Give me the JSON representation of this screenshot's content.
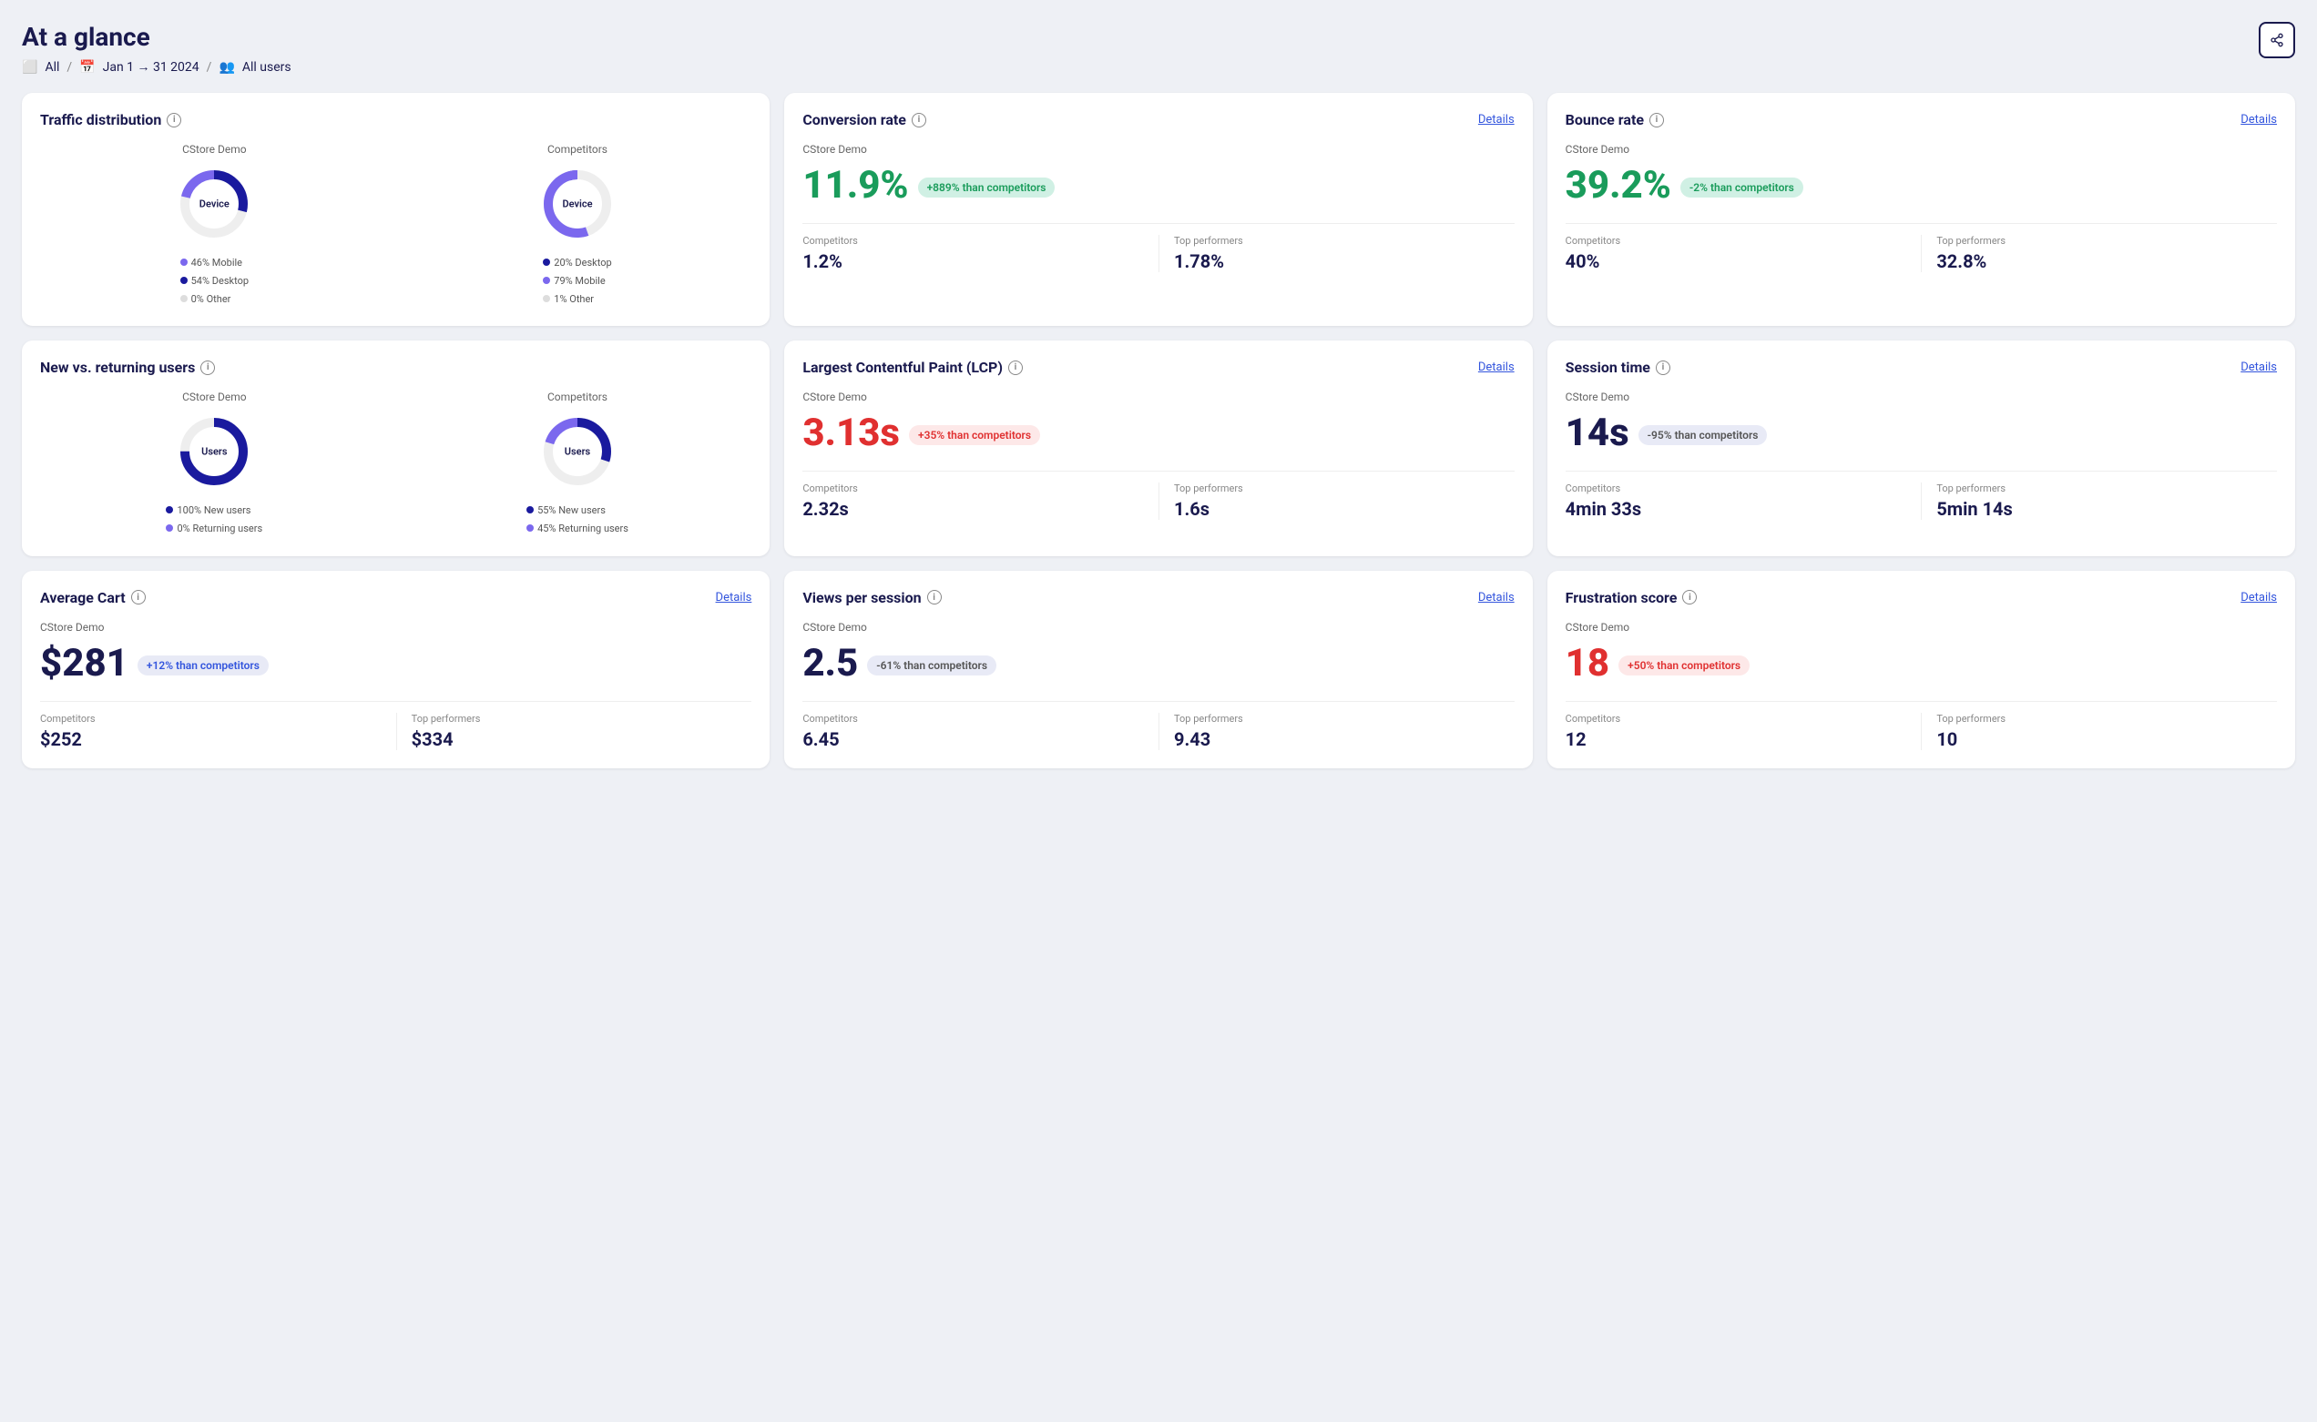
{
  "header": {
    "title": "At a glance",
    "filter_all": "All",
    "filter_date": "Jan 1 → 31 2024",
    "filter_users": "All users",
    "share_label": "share"
  },
  "cards": {
    "traffic": {
      "title": "Traffic distribution",
      "cstore_label": "CStore Demo",
      "competitors_label": "Competitors",
      "cstore_donut_center": "Device",
      "competitors_donut_center": "Device",
      "cstore_legend": [
        "46% Mobile",
        "54% Desktop",
        "0% Other"
      ],
      "competitors_legend": [
        "20% Desktop",
        "79% Mobile",
        "1% Other"
      ],
      "cstore_colors": [
        "#7b68ee",
        "#1a1a9e",
        "#ddd"
      ],
      "competitors_colors": [
        "#1a1a9e",
        "#7b68ee",
        "#ddd"
      ],
      "cstore_pcts": [
        46,
        54,
        0
      ],
      "competitors_pcts": [
        20,
        79,
        1
      ]
    },
    "conversion": {
      "title": "Conversion rate",
      "details_label": "Details",
      "cstore_label": "CStore Demo",
      "big_value": "11.9%",
      "badge_text": "+889% than competitors",
      "badge_type": "green",
      "competitors_label": "Competitors",
      "competitors_value": "1.2%",
      "top_performers_label": "Top performers",
      "top_performers_value": "1.78%"
    },
    "bounce": {
      "title": "Bounce rate",
      "details_label": "Details",
      "cstore_label": "CStore Demo",
      "big_value": "39.2%",
      "badge_text": "-2% than competitors",
      "badge_type": "green",
      "competitors_label": "Competitors",
      "competitors_value": "40%",
      "top_performers_label": "Top performers",
      "top_performers_value": "32.8%"
    },
    "new_returning": {
      "title": "New vs. returning users",
      "cstore_label": "CStore Demo",
      "competitors_label": "Competitors",
      "cstore_donut_center": "Users",
      "competitors_donut_center": "Users",
      "cstore_legend": [
        "100% New users",
        "0% Returning users"
      ],
      "competitors_legend": [
        "55% New users",
        "45% Returning users"
      ],
      "cstore_colors": [
        "#1a1a9e",
        "#7b68ee"
      ],
      "competitors_colors": [
        "#1a1a9e",
        "#7b68ee"
      ],
      "cstore_pcts": [
        100,
        0
      ],
      "competitors_pcts": [
        55,
        45
      ]
    },
    "lcp": {
      "title": "Largest Contentful Paint (LCP)",
      "details_label": "Details",
      "cstore_label": "CStore Demo",
      "big_value": "3.13s",
      "badge_text": "+35% than competitors",
      "badge_type": "red",
      "competitors_label": "Competitors",
      "competitors_value": "2.32s",
      "top_performers_label": "Top performers",
      "top_performers_value": "1.6s"
    },
    "session": {
      "title": "Session time",
      "details_label": "Details",
      "cstore_label": "CStore Demo",
      "big_value": "14s",
      "badge_text": "-95% than competitors",
      "badge_type": "gray",
      "competitors_label": "Competitors",
      "competitors_value": "4min 33s",
      "top_performers_label": "Top performers",
      "top_performers_value": "5min 14s"
    },
    "avg_cart": {
      "title": "Average Cart",
      "details_label": "Details",
      "cstore_label": "CStore Demo",
      "big_value": "$281",
      "badge_text": "+12% than competitors",
      "badge_type": "blue",
      "competitors_label": "Competitors",
      "competitors_value": "$252",
      "top_performers_label": "Top performers",
      "top_performers_value": "$334"
    },
    "views": {
      "title": "Views per session",
      "details_label": "Details",
      "cstore_label": "CStore Demo",
      "big_value": "2.5",
      "badge_text": "-61% than competitors",
      "badge_type": "gray",
      "competitors_label": "Competitors",
      "competitors_value": "6.45",
      "top_performers_label": "Top performers",
      "top_performers_value": "9.43"
    },
    "frustration": {
      "title": "Frustration score",
      "details_label": "Details",
      "cstore_label": "CStore Demo",
      "big_value": "18",
      "badge_text": "+50% than competitors",
      "badge_type": "red",
      "competitors_label": "Competitors",
      "competitors_value": "12",
      "top_performers_label": "Top performers",
      "top_performers_value": "10"
    }
  }
}
